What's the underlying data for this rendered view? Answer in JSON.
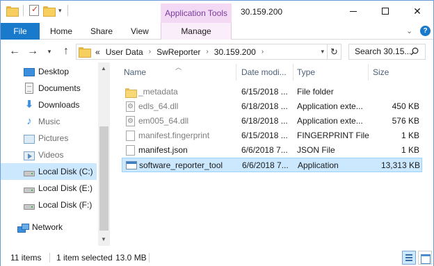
{
  "window": {
    "title": "30.159.200",
    "context_tab_label": "Application Tools"
  },
  "ribbon": {
    "tabs": [
      {
        "label": "File"
      },
      {
        "label": "Home"
      },
      {
        "label": "Share"
      },
      {
        "label": "View"
      },
      {
        "label": "Manage"
      }
    ]
  },
  "address": {
    "overflow_label": "«",
    "crumbs": [
      "User Data",
      "SwReporter",
      "30.159.200"
    ]
  },
  "search": {
    "placeholder": "Search 30.15..."
  },
  "sidebar": {
    "items": [
      {
        "label": "Desktop",
        "icon": "desktop-icon"
      },
      {
        "label": "Documents",
        "icon": "documents-icon"
      },
      {
        "label": "Downloads",
        "icon": "downloads-icon"
      },
      {
        "label": "Music",
        "icon": "music-icon"
      },
      {
        "label": "Pictures",
        "icon": "pictures-icon"
      },
      {
        "label": "Videos",
        "icon": "videos-icon"
      },
      {
        "label": "Local Disk (C:)",
        "icon": "disk-icon",
        "selected": true
      },
      {
        "label": "Local Disk (E:)",
        "icon": "disk-icon"
      },
      {
        "label": "Local Disk (F:)",
        "icon": "disk-icon"
      },
      {
        "label": "Network",
        "icon": "network-icon"
      }
    ]
  },
  "columns": {
    "name": "Name",
    "date": "Date modi...",
    "type": "Type",
    "size": "Size"
  },
  "files": [
    {
      "name": "_metadata",
      "date": "6/15/2018 ...",
      "type": "File folder",
      "size": "",
      "icon": "folder-icon",
      "hidden": true
    },
    {
      "name": "edls_64.dll",
      "date": "6/18/2018 ...",
      "type": "Application exte...",
      "size": "450 KB",
      "icon": "dll-icon",
      "hidden": true
    },
    {
      "name": "em005_64.dll",
      "date": "6/18/2018 ...",
      "type": "Application exte...",
      "size": "576 KB",
      "icon": "dll-icon",
      "hidden": true
    },
    {
      "name": "manifest.fingerprint",
      "date": "6/15/2018 ...",
      "type": "FINGERPRINT File",
      "size": "1 KB",
      "icon": "file-icon",
      "hidden": true
    },
    {
      "name": "manifest.json",
      "date": "6/6/2018 7...",
      "type": "JSON File",
      "size": "1 KB",
      "icon": "file-icon",
      "hidden": false
    },
    {
      "name": "software_reporter_tool",
      "date": "6/6/2018 7...",
      "type": "Application",
      "size": "13,313 KB",
      "icon": "application-icon",
      "hidden": false,
      "selected": true
    }
  ],
  "status": {
    "item_count": "11 items",
    "selection": "1 item selected",
    "selection_size": "13.0 MB"
  }
}
